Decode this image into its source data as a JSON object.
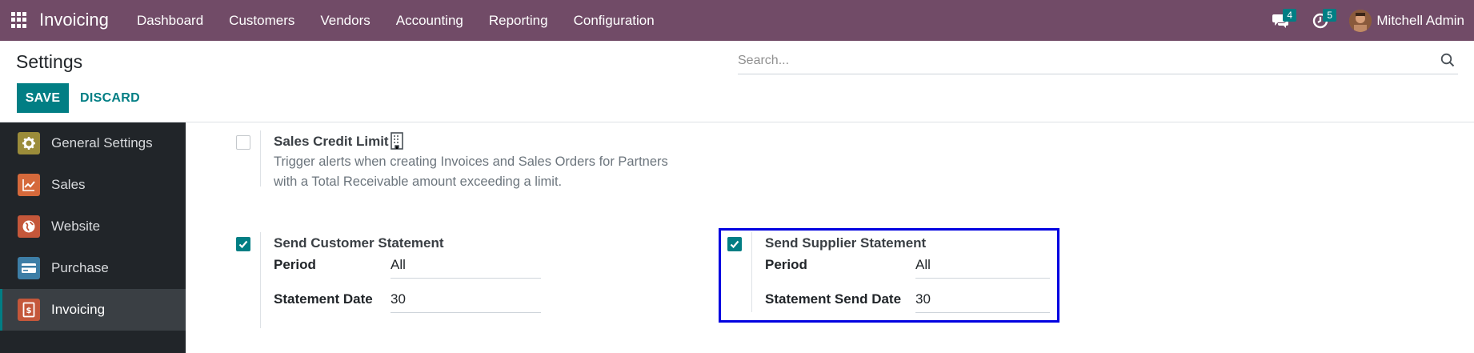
{
  "navbar": {
    "app_name": "Invoicing",
    "menu": [
      "Dashboard",
      "Customers",
      "Vendors",
      "Accounting",
      "Reporting",
      "Configuration"
    ],
    "messages_count": "4",
    "activities_count": "5",
    "user_name": "Mitchell Admin"
  },
  "control_panel": {
    "title": "Settings",
    "search_placeholder": "Search...",
    "save_label": "SAVE",
    "discard_label": "DISCARD"
  },
  "sidebar": {
    "items": [
      {
        "label": "General Settings",
        "icon": "gear-icon",
        "color": "#9b8c3a"
      },
      {
        "label": "Sales",
        "icon": "chart-icon",
        "color": "#d5693b"
      },
      {
        "label": "Website",
        "icon": "globe-icon",
        "color": "#c4573a"
      },
      {
        "label": "Purchase",
        "icon": "card-icon",
        "color": "#3d7ea6"
      },
      {
        "label": "Invoicing",
        "icon": "invoice-icon",
        "color": "#c4573a"
      }
    ],
    "active": "Invoicing"
  },
  "settings": {
    "credit_limit": {
      "title": "Sales Credit Limit",
      "description_line1": "Trigger alerts when creating Invoices and Sales Orders for Partners",
      "description_line2": "with a Total Receivable amount exceeding a limit.",
      "checked": false
    },
    "customer_statement": {
      "title": "Send Customer Statement",
      "checked": true,
      "period_label": "Period",
      "period_value": "All",
      "date_label": "Statement Date",
      "date_value": "30"
    },
    "supplier_statement": {
      "title": "Send Supplier Statement",
      "checked": true,
      "period_label": "Period",
      "period_value": "All",
      "date_label": "Statement Send Date",
      "date_value": "30"
    }
  },
  "colors": {
    "navbar": "#714B67",
    "accent": "#017e84",
    "highlight": "#0000e0"
  }
}
